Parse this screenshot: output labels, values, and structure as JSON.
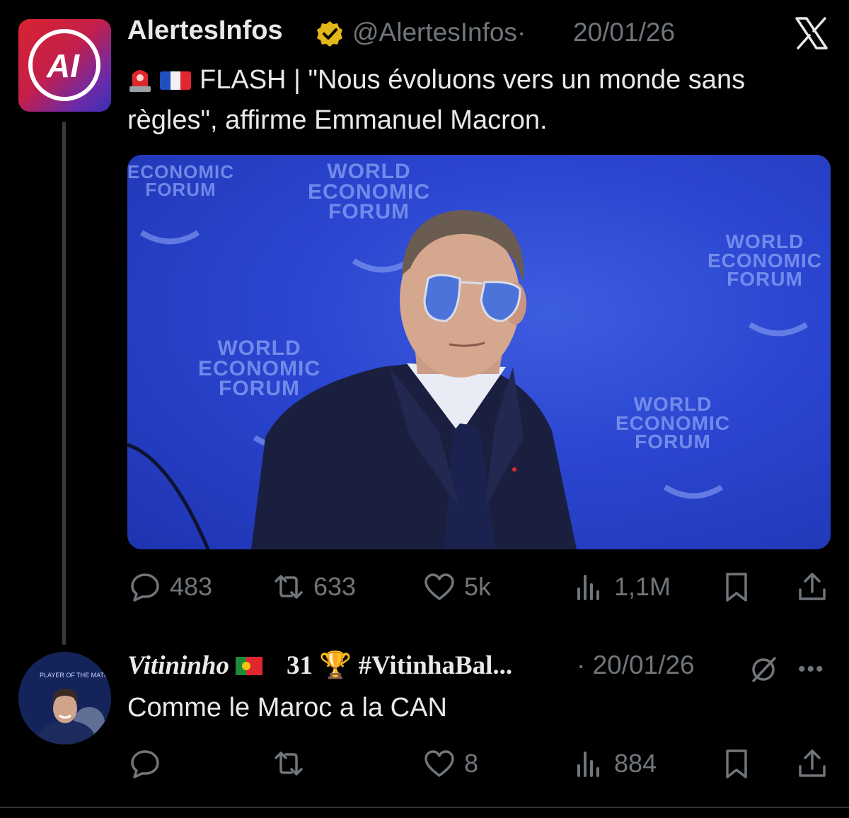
{
  "tweet": {
    "author_name": "AlertesInfos",
    "author_handle": "@AlertesInfos",
    "separator": "·",
    "date": "20/01/26",
    "avatar_text": "AI",
    "text": "FLASH | \"Nous évoluons vers un monde sans règles\", affirme Emmanuel Macron.",
    "image_text": [
      "WORLD",
      "ECONOMIC",
      "FORUM"
    ],
    "stats": {
      "replies": "483",
      "reposts": "633",
      "likes": "5k",
      "views": "1,1M"
    }
  },
  "reply": {
    "author_name": "Vitininho",
    "author_name_rest": "31 🏆 #VitinhaBal...",
    "separator": "·",
    "date": "20/01/26",
    "text": "Comme le Maroc a la CAN",
    "stats": {
      "replies": "",
      "reposts": "",
      "likes": "8",
      "views": "884"
    },
    "avatar_text": [
      "PLAYER OF THE MATCH"
    ]
  },
  "colors": {
    "background": "#000000",
    "text_primary": "#e7e9ea",
    "text_secondary": "#71767b",
    "verified_gold": "#e2b719",
    "wef_blue": "#2a45d0"
  },
  "icons": [
    "reply-icon",
    "repost-icon",
    "like-icon",
    "views-icon",
    "bookmark-icon",
    "share-icon",
    "x-logo-icon",
    "verified-badge-icon",
    "grok-icon",
    "more-icon",
    "siren-icon",
    "france-flag-icon",
    "portugal-flag-icon"
  ]
}
